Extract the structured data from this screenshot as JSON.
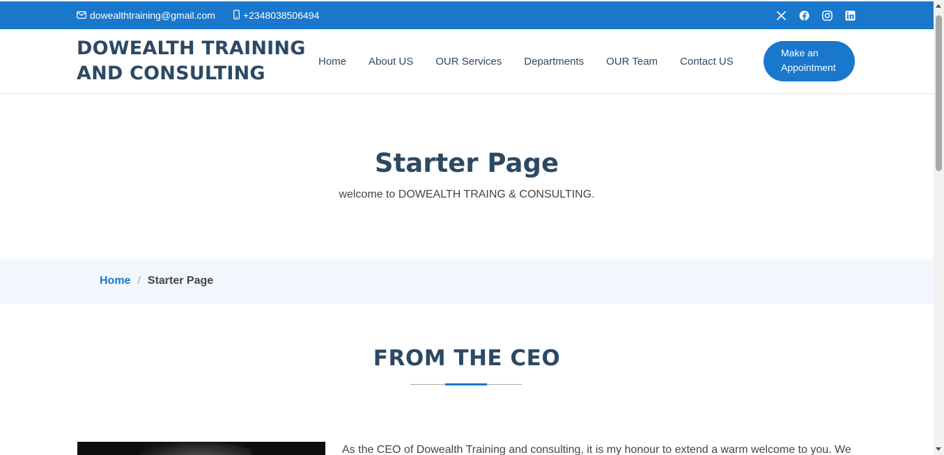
{
  "topbar": {
    "email": "dowealthtraining@gmail.com",
    "phone": "+2348038506494",
    "social": [
      "x-twitter-icon",
      "facebook-icon",
      "instagram-icon",
      "linkedin-icon"
    ],
    "color": "#1977cc"
  },
  "header": {
    "logo_line1": "DOWEALTH TRAINING",
    "logo_line2": "AND CONSULTING",
    "nav": [
      {
        "label": "Home"
      },
      {
        "label": "About US"
      },
      {
        "label": "OUR Services"
      },
      {
        "label": "Departments"
      },
      {
        "label": "OUR Team"
      },
      {
        "label": "Contact US"
      }
    ],
    "cta_line1": "Make an",
    "cta_line2": "Appointment"
  },
  "hero": {
    "title": "Starter Page",
    "subtitle": "welcome to DOWEALTH TRAING & CONSULTING."
  },
  "breadcrumb": {
    "home": "Home",
    "separator": "/",
    "current": "Starter Page"
  },
  "section": {
    "title": "FROM THE CEO",
    "text": "As the CEO of Dowealth Training and consulting, it is my honour to extend a warm welcome to you. We"
  },
  "colors": {
    "accent": "#1977cc",
    "heading": "#2c4964",
    "breadcrumb_bg": "#f1f7fc"
  }
}
